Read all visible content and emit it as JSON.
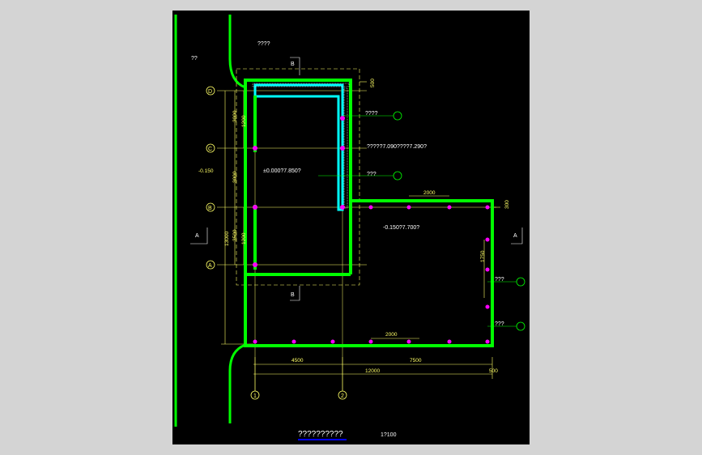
{
  "plan": {
    "top_note": "????",
    "left_note": "??",
    "section_b_top": "B",
    "section_b_bottom": "B",
    "section_a_left": "A",
    "section_a_right": "A",
    "axis_d": "D",
    "axis_c": "C",
    "axis_b": "B",
    "axis_a": "A",
    "axis_1": "1",
    "axis_2": "2",
    "label_500_top": "500",
    "label_note1": "????",
    "label_note2": "?????7.090????7.290?",
    "label_elev1": "±0.000?7.850?",
    "label_note3": "???",
    "label_2000_top": "2000",
    "label_300_right": "300",
    "label_elev2": "-0.150?7.700?",
    "label_1750": "1750",
    "label_note4": "???",
    "label_note5": "???",
    "label_2000_bottom": "2000",
    "label_4500": "4500",
    "label_7500": "7500",
    "label_12000": "12000",
    "label_500_bottom": "500",
    "label_3000a": "3000",
    "label_1200a": "1200",
    "label_3000b": "3000",
    "label_3500": "3500",
    "label_1200b": "1200",
    "label_13000": "13000",
    "label_minus150": "-0.150",
    "title": "??????????",
    "scale": "1?100"
  },
  "colors": {
    "background": "#000000",
    "green": "#00ff00",
    "cyan": "#00ffff",
    "yellow": "#ffff66",
    "magenta": "#ff00ff",
    "blue": "#0000ff"
  }
}
